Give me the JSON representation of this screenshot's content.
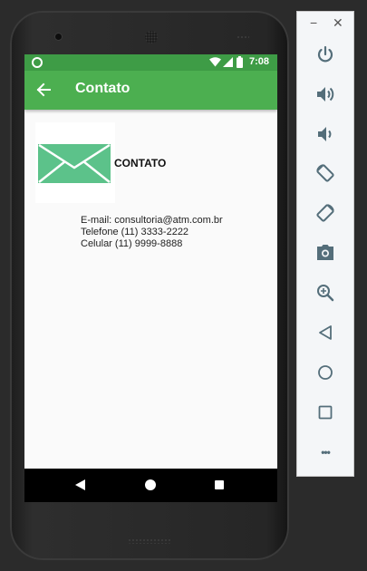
{
  "status_bar": {
    "time": "7:08"
  },
  "app_bar": {
    "title": "Contato"
  },
  "content": {
    "heading": "CONTATO",
    "email": "E-mail: consultoria@atm.com.br",
    "phone": "Telefone (11) 3333-2222",
    "mobile": "Celular (11) 9999-8888"
  },
  "toolbar": {
    "minimize_glyph": "−",
    "close_glyph": "✕",
    "buttons": [
      "power-icon",
      "volume-up-icon",
      "volume-down-icon",
      "rotate-left-icon",
      "rotate-right-icon",
      "camera-icon",
      "zoom-icon",
      "back-icon",
      "home-icon",
      "overview-icon",
      "more-icon"
    ],
    "more_glyph": "•••"
  },
  "colors": {
    "status_bar": "#3e9c46",
    "app_bar": "#4caf50",
    "envelope": "#5cc28a",
    "toolbar_icon": "#546e7a"
  }
}
